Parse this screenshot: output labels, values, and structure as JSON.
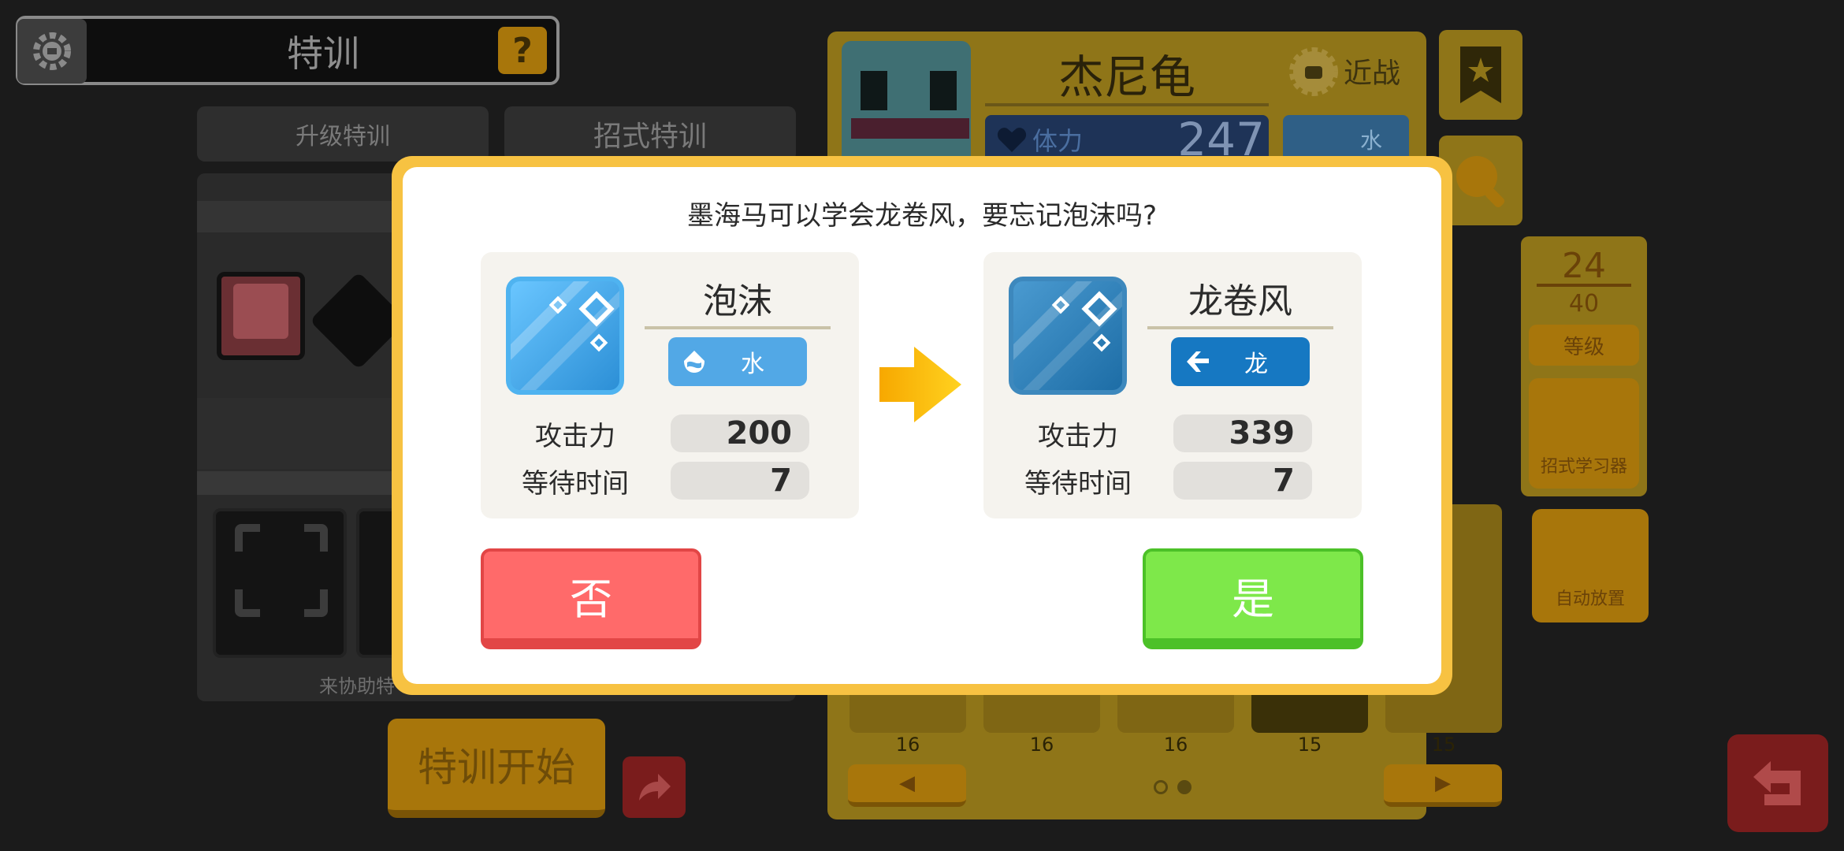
{
  "header": {
    "title": "特训",
    "help_label": "?"
  },
  "tabs": [
    {
      "label": "升级特训"
    },
    {
      "label": "招式特训"
    }
  ],
  "left_panel": {
    "footer_text": "来协助特"
  },
  "start_button": {
    "label": "特训开始"
  },
  "pokemon": {
    "name": "杰尼龟",
    "style": "近战",
    "hp_label": "体力",
    "hp_value": "247",
    "type": "水"
  },
  "side": {
    "level": "24",
    "level_max": "40",
    "level_label": "等级",
    "learner_label": "招式学习器",
    "auto_label": "自动放置"
  },
  "team_levels": [
    "16",
    "16",
    "16",
    "15",
    "15"
  ],
  "pager": {
    "prev": "◀",
    "next": "▶"
  },
  "dialog": {
    "message": "墨海马可以学会龙卷风，要忘记泡沫吗?",
    "old_move": {
      "name": "泡沫",
      "type": "水",
      "attack_label": "攻击力",
      "attack": "200",
      "wait_label": "等待时间",
      "wait": "7"
    },
    "new_move": {
      "name": "龙卷风",
      "type": "龙",
      "attack_label": "攻击力",
      "attack": "339",
      "wait_label": "等待时间",
      "wait": "7"
    },
    "no_label": "否",
    "yes_label": "是"
  },
  "colors": {
    "dialog_border": "#f7c242",
    "water": "#52a8e6",
    "dragon": "#1678c2",
    "no": "#ff6a6a",
    "yes": "#7ee84a"
  },
  "icons": [
    "gear-icon",
    "help-icon",
    "melee-icon",
    "heart-icon",
    "bookmark-icon",
    "search-icon",
    "share-icon",
    "return-icon",
    "arrow-right-icon",
    "water-type-icon",
    "dragon-type-icon"
  ]
}
